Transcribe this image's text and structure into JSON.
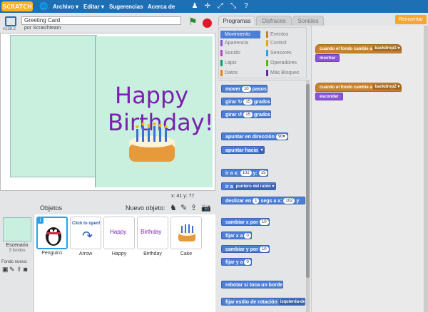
{
  "menubar": {
    "logo": "SCRATCH",
    "items": [
      "Archivo ▾",
      "Editar ▾",
      "Sugerencias",
      "Acerca de"
    ],
    "tools": [
      "person-icon",
      "move-icon",
      "grow-icon",
      "shrink-icon",
      "help-icon"
    ]
  },
  "project": {
    "title": "Greeting Card",
    "byline": "por Scratchteam",
    "version": "v138.2"
  },
  "stage": {
    "happy_text": "Happy",
    "birthday_text": "Birthday!",
    "coords": "x: 41   y: 77"
  },
  "sprites": {
    "header": "Objetos",
    "new_sprite": "Nuevo objeto:",
    "backdrop_label": "Escenario",
    "backdrop_count": "3 fondos",
    "new_backdrop": "Fondo nuevo:",
    "items": [
      {
        "name": "Penguin1",
        "selected": true
      },
      {
        "name": "Arrow",
        "selected": false
      },
      {
        "name": "Happy",
        "selected": false
      },
      {
        "name": "Birthday",
        "selected": false
      },
      {
        "name": "Cake",
        "selected": false
      }
    ],
    "arrow_thumb_text": "Click to open!",
    "happy_thumb_text": "Happy",
    "birthday_thumb_text": "Birthday"
  },
  "tabs": [
    "Programas",
    "Disfraces",
    "Sonidos"
  ],
  "new_extension": "Reinventar",
  "categories": [
    {
      "label": "Movimiento",
      "color": "#4c7ed6",
      "active": true
    },
    {
      "label": "Apariencia",
      "color": "#8a55d7"
    },
    {
      "label": "Sonido",
      "color": "#bb42c3"
    },
    {
      "label": "Lápiz",
      "color": "#0e9a6c"
    },
    {
      "label": "Datos",
      "color": "#ee7d16"
    },
    {
      "label": "Eventos",
      "color": "#c88330"
    },
    {
      "label": "Control",
      "color": "#e1a91a"
    },
    {
      "label": "Sensores",
      "color": "#2ca5e2"
    },
    {
      "label": "Operadores",
      "color": "#5cb712"
    },
    {
      "label": "Más Bloques",
      "color": "#632d99"
    }
  ],
  "blocks": {
    "move": {
      "pre": "mover",
      "val": "10",
      "post": "pasos"
    },
    "turn_right": {
      "pre": "girar ↻",
      "val": "15",
      "post": "grados"
    },
    "turn_left": {
      "pre": "girar ↺",
      "val": "15",
      "post": "grados"
    },
    "point_dir": {
      "pre": "apuntar en dirección",
      "val": "90▾"
    },
    "point_towards": {
      "pre": "apuntar hacia",
      "dd": "▾"
    },
    "goto_xy": {
      "pre": "ir a x:",
      "x": "102",
      "mid": "y:",
      "y": "15"
    },
    "goto": {
      "pre": "ir a",
      "dd": "puntero del ratón ▾"
    },
    "glide": {
      "pre": "deslizar en",
      "val": "1",
      "mid": "segs a x:",
      "x": "102",
      "post": "y"
    },
    "change_x": {
      "pre": "cambiar x por",
      "val": "10"
    },
    "set_x": {
      "pre": "fijar x a",
      "val": "0"
    },
    "change_y": {
      "pre": "cambiar y por",
      "val": "10"
    },
    "set_y": {
      "pre": "fijar y a",
      "val": "0"
    },
    "bounce": {
      "pre": "rebotar si toca un borde"
    },
    "rotation": {
      "pre": "fijar estilo de rotación",
      "dd": "izquierda-derecha ▾"
    }
  },
  "scripts": [
    {
      "hat": "cuando el fondo cambie a",
      "hat_dd": "backdrop1 ▾",
      "action": "mostrar"
    },
    {
      "hat": "cuando el fondo cambie a",
      "hat_dd": "backdrop2 ▾",
      "action": "esconder"
    }
  ]
}
